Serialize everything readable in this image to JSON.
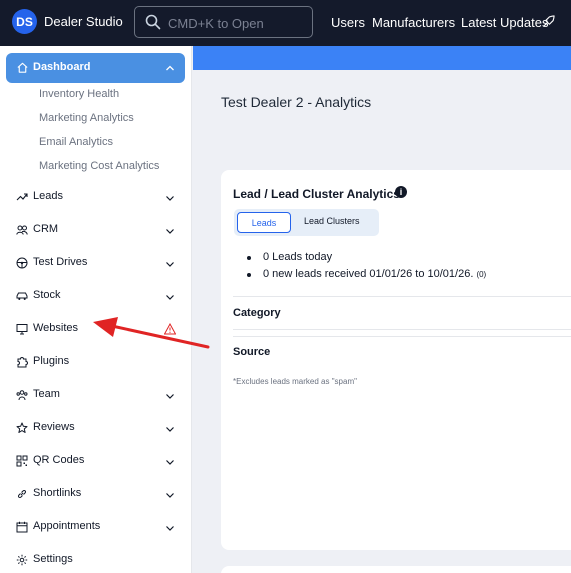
{
  "topbar": {
    "logo": "DS",
    "brand": "Dealer Studio",
    "search_placeholder": "CMD+K to Open",
    "links": [
      "Users",
      "Manufacturers",
      "Latest Updates"
    ]
  },
  "sidebar": {
    "dashboard": "Dashboard",
    "sub_items": [
      "Inventory Health",
      "Marketing Analytics",
      "Email Analytics",
      "Marketing Cost Analytics"
    ],
    "items": [
      {
        "label": "Leads",
        "icon": "trend-icon"
      },
      {
        "label": "CRM",
        "icon": "users-icon"
      },
      {
        "label": "Test Drives",
        "icon": "steering-wheel-icon"
      },
      {
        "label": "Stock",
        "icon": "car-icon"
      },
      {
        "label": "Websites",
        "icon": "monitor-icon"
      },
      {
        "label": "Plugins",
        "icon": "puzzle-icon"
      },
      {
        "label": "Team",
        "icon": "team-icon"
      },
      {
        "label": "Reviews",
        "icon": "star-icon"
      },
      {
        "label": "QR Codes",
        "icon": "qr-icon"
      },
      {
        "label": "Shortlinks",
        "icon": "link-icon"
      },
      {
        "label": "Appointments",
        "icon": "calendar-icon"
      },
      {
        "label": "Settings",
        "icon": "gear-icon"
      }
    ]
  },
  "main": {
    "page_title": "Test Dealer 2 - Analytics",
    "card": {
      "title": "Lead / Lead Cluster Analytics",
      "tabs": [
        "Leads",
        "Lead Clusters"
      ],
      "bullets": [
        "0 Leads today",
        "0 new leads received 01/01/26 to 10/01/26."
      ],
      "bullet_count": "(0)",
      "sections": [
        "Category",
        "Source"
      ],
      "note": "*Excludes leads marked as \"spam\""
    }
  },
  "colors": {
    "topbar": "#141a2b",
    "accent": "#4a90e2",
    "arrow": "#e02424",
    "warning": "#e02424"
  }
}
